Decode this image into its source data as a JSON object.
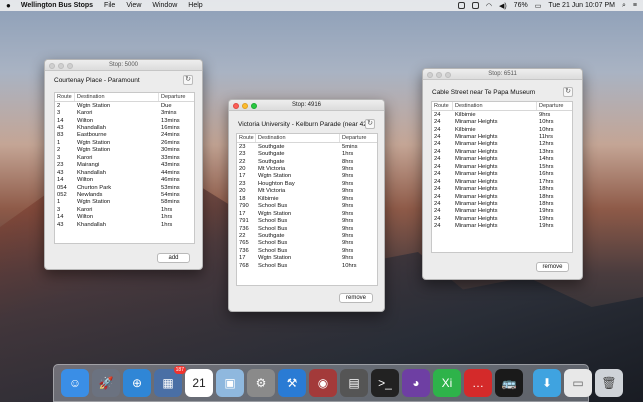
{
  "menubar": {
    "app": "Wellington Bus Stops",
    "items": [
      "File",
      "View",
      "Window",
      "Help"
    ],
    "status": {
      "battery": "76%",
      "clock": "Tue 21 Jun  10:07 PM"
    }
  },
  "windows": [
    {
      "title": "Stop: 5000",
      "location": "Courtenay Place - Paramount",
      "button": "add",
      "columns": [
        "Route",
        "Destination",
        "Departure"
      ],
      "rows": [
        [
          "2",
          "Wgtn Station",
          "Due"
        ],
        [
          "3",
          "Karori",
          "3mins"
        ],
        [
          "14",
          "Wilton",
          "13mins"
        ],
        [
          "43",
          "Khandallah",
          "16mins"
        ],
        [
          "83",
          "Eastbourne",
          "24mins"
        ],
        [
          "1",
          "Wgtn Station",
          "26mins"
        ],
        [
          "2",
          "Wgtn Station",
          "30mins"
        ],
        [
          "3",
          "Karori",
          "33mins"
        ],
        [
          "23",
          "Mairangi",
          "43mins"
        ],
        [
          "43",
          "Khandallah",
          "44mins"
        ],
        [
          "14",
          "Wilton",
          "46mins"
        ],
        [
          "054",
          "Churton Park",
          "53mins"
        ],
        [
          "052",
          "Newlands",
          "54mins"
        ],
        [
          "1",
          "Wgtn Station",
          "58mins"
        ],
        [
          "3",
          "Karori",
          "1hrs"
        ],
        [
          "14",
          "Wilton",
          "1hrs"
        ],
        [
          "43",
          "Khandallah",
          "1hrs"
        ]
      ]
    },
    {
      "title": "Stop: 4916",
      "location": "Victoria University - Kelburn Parade (near 42)",
      "button": "remove",
      "columns": [
        "Route",
        "Destination",
        "Departure"
      ],
      "rows": [
        [
          "23",
          "Southgate",
          "5mins"
        ],
        [
          "23",
          "Southgate",
          "1hrs"
        ],
        [
          "22",
          "Southgate",
          "8hrs"
        ],
        [
          "20",
          "Mt Victoria",
          "9hrs"
        ],
        [
          "17",
          "Wgtn Station",
          "9hrs"
        ],
        [
          "23",
          "Houghton Bay",
          "9hrs"
        ],
        [
          "20",
          "Mt Victoria",
          "9hrs"
        ],
        [
          "18",
          "Kilbirnie",
          "9hrs"
        ],
        [
          "790",
          "School Bus",
          "9hrs"
        ],
        [
          "17",
          "Wgtn Station",
          "9hrs"
        ],
        [
          "791",
          "School Bus",
          "9hrs"
        ],
        [
          "736",
          "School Bus",
          "9hrs"
        ],
        [
          "22",
          "Southgate",
          "9hrs"
        ],
        [
          "765",
          "School Bus",
          "9hrs"
        ],
        [
          "736",
          "School Bus",
          "9hrs"
        ],
        [
          "17",
          "Wgtn Station",
          "9hrs"
        ],
        [
          "768",
          "School Bus",
          "10hrs"
        ]
      ]
    },
    {
      "title": "Stop: 6511",
      "location": "Cable Street near Te Papa Museum",
      "button": "remove",
      "columns": [
        "Route",
        "Destination",
        "Departure"
      ],
      "rows": [
        [
          "24",
          "Kilbirnie",
          "9hrs"
        ],
        [
          "24",
          "Miramar Heights",
          "10hrs"
        ],
        [
          "24",
          "Kilbirnie",
          "10hrs"
        ],
        [
          "24",
          "Miramar Heights",
          "11hrs"
        ],
        [
          "24",
          "Miramar Heights",
          "12hrs"
        ],
        [
          "24",
          "Miramar Heights",
          "13hrs"
        ],
        [
          "24",
          "Miramar Heights",
          "14hrs"
        ],
        [
          "24",
          "Miramar Heights",
          "15hrs"
        ],
        [
          "24",
          "Miramar Heights",
          "16hrs"
        ],
        [
          "24",
          "Miramar Heights",
          "17hrs"
        ],
        [
          "24",
          "Miramar Heights",
          "18hrs"
        ],
        [
          "24",
          "Miramar Heights",
          "18hrs"
        ],
        [
          "24",
          "Miramar Heights",
          "18hrs"
        ],
        [
          "24",
          "Miramar Heights",
          "19hrs"
        ],
        [
          "24",
          "Miramar Heights",
          "19hrs"
        ],
        [
          "24",
          "Miramar Heights",
          "19hrs"
        ]
      ]
    }
  ],
  "dock": [
    {
      "name": "finder-icon",
      "color": "#3a8ee6",
      "glyph": "☺"
    },
    {
      "name": "launchpad-icon",
      "color": "#6b7280",
      "glyph": "🚀"
    },
    {
      "name": "safari-icon",
      "color": "#2f86d6",
      "glyph": "⊕"
    },
    {
      "name": "photo-app-icon",
      "color": "#4a6fa5",
      "glyph": "▦",
      "badge": "187"
    },
    {
      "name": "calendar-icon",
      "color": "#ffffff",
      "glyph": "21",
      "text": "#222"
    },
    {
      "name": "preview-icon",
      "color": "#8fb8de",
      "glyph": "▣"
    },
    {
      "name": "system-preferences-icon",
      "color": "#8a8a8a",
      "glyph": "⚙"
    },
    {
      "name": "xcode-icon",
      "color": "#2a7bd4",
      "glyph": "⚒"
    },
    {
      "name": "photo-booth-icon",
      "color": "#a33a3a",
      "glyph": "◉"
    },
    {
      "name": "image-capture-icon",
      "color": "#555",
      "glyph": "▤"
    },
    {
      "name": "terminal-icon",
      "color": "#222",
      "glyph": ">_"
    },
    {
      "name": "github-icon",
      "color": "#6e3fa3",
      "glyph": "◕"
    },
    {
      "name": "xi-icon",
      "color": "#2eb34a",
      "glyph": "Xi"
    },
    {
      "name": "chat-icon",
      "color": "#d42a2a",
      "glyph": "…"
    },
    {
      "name": "bus-app-icon",
      "color": "#1a1a1a",
      "glyph": "🚌"
    },
    {
      "name": "downloads-folder-icon",
      "color": "#3fa3e0",
      "glyph": "⬇"
    },
    {
      "name": "document-icon",
      "color": "#e8e8e8",
      "glyph": "▭",
      "text": "#666"
    },
    {
      "name": "trash-icon",
      "color": "#cfd3d8",
      "glyph": "🗑",
      "text": "#444"
    }
  ]
}
